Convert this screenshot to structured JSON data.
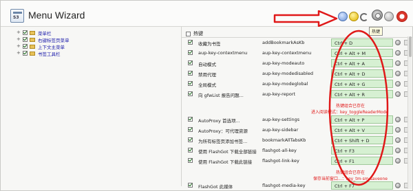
{
  "window": {
    "title": "Menu Wizard",
    "logo_text": "S3",
    "tooltip": "热键"
  },
  "tree": [
    {
      "label": "菜单栏",
      "checked": true
    },
    {
      "label": "右键标签页菜单",
      "checked": true
    },
    {
      "label": "上下文主菜单",
      "checked": true
    },
    {
      "label": "书签工具栏",
      "checked": true
    }
  ],
  "hotkeys": {
    "group_label": "热键",
    "group_checked": false,
    "rows": [
      {
        "name": "收藏为书签",
        "key": "addBookmarkAsKb",
        "hotkey": "Ctrl + D",
        "checked": true
      },
      {
        "name": "aup-key-contextmenu",
        "key": "aup-key-contextmenu",
        "hotkey": "Ctrl + Alt + M",
        "checked": true
      },
      {
        "name": "自动模式",
        "key": "aup-key-modeauto",
        "hotkey": "Ctrl + Alt + A",
        "checked": true
      },
      {
        "name": "禁用代理",
        "key": "aup-key-modedisabled",
        "hotkey": "Ctrl + Alt + D",
        "checked": true
      },
      {
        "name": "全局模式",
        "key": "aup-key-modeglobal",
        "hotkey": "Ctrl + Alt + G",
        "checked": true
      },
      {
        "name": "向 gfwList 报告问题...",
        "key": "aup-key-report",
        "hotkey": "Ctrl + Alt + R",
        "checked": true
      },
      {
        "name": "AutoProxy 首选项...",
        "key": "aup-key-settings",
        "hotkey": "Ctrl + Alt + P",
        "checked": true
      },
      {
        "name": "AutoProxy：可代理资源",
        "key": "aup-key-sidebar",
        "hotkey": "Ctrl + Alt + V",
        "checked": true
      },
      {
        "name": "为所有标签页添加书签...",
        "key": "bookmarkAllTabsKb",
        "hotkey": "Ctrl + Shift + D",
        "checked": true
      },
      {
        "name": "使用 FlashGot 下载全部链接",
        "key": "flashgot-all-key",
        "hotkey": "Ctrl + F3",
        "checked": true
      },
      {
        "name": "使用 FlashGot 下载此链接",
        "key": "flashgot-link-key",
        "hotkey": "Ctrl + F1",
        "checked": true
      },
      {
        "name": "FlashGot 此媒体",
        "key": "flashgot-media-key",
        "hotkey": "Ctrl + F7",
        "checked": true
      }
    ],
    "warnings": [
      {
        "line1": "热键组合已存在",
        "line2": "进入阅读模式：key_toggleReaderMode"
      },
      {
        "line1": "热键组合已存在",
        "line2": "保存当前窗口...：key_tm-sm-saveone"
      }
    ]
  },
  "colors": {
    "annotation_red": "#e01818",
    "hotkey_field": "#d6f0d2",
    "link_blue": "#1c1caa"
  }
}
